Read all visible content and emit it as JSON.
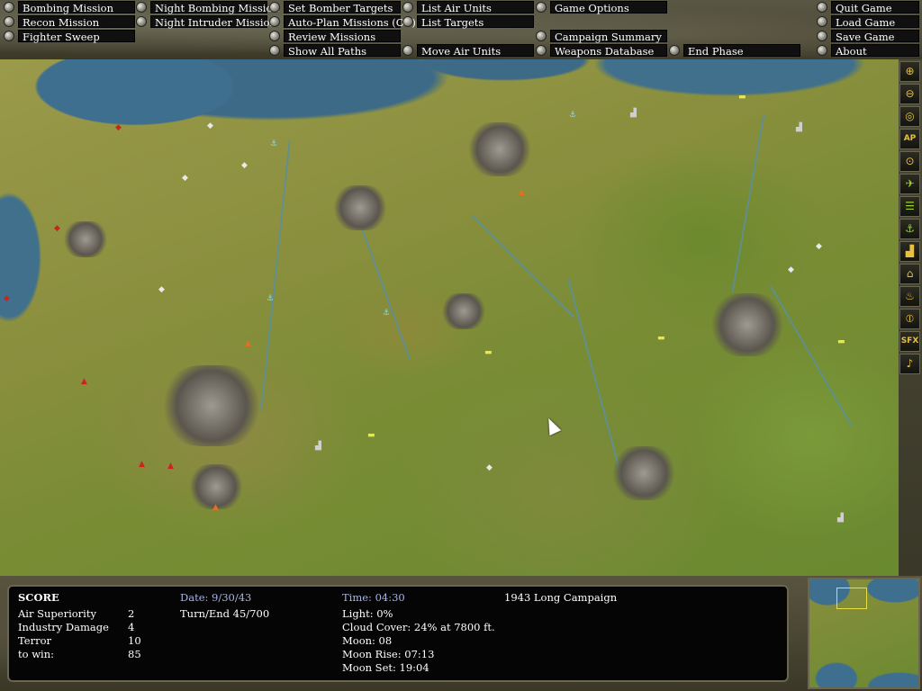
{
  "menu": {
    "bombing_mission": "Bombing Mission",
    "recon_mission": "Recon Mission",
    "fighter_sweep": "Fighter Sweep",
    "night_bombing_mission": "Night Bombing Mission",
    "night_intruder_mission": "Night Intruder Mission",
    "set_bomber_targets": "Set Bomber Targets",
    "auto_plan_missions": "Auto-Plan Missions (Off)",
    "review_missions": "Review Missions",
    "show_all_paths": "Show All Paths",
    "list_air_units": "List Air Units",
    "list_targets": "List Targets",
    "move_air_units": "Move Air Units",
    "game_options": "Game Options",
    "campaign_summary": "Campaign Summary",
    "weapons_database": "Weapons Database",
    "end_phase": "End Phase",
    "quit_game": "Quit Game",
    "load_game": "Load Game",
    "save_game": "Save Game",
    "about": "About"
  },
  "toolbar": {
    "ap_label": "AP",
    "sfx_label": "SFX",
    "icons": [
      "zoom-in-icon",
      "zoom-out-icon",
      "center-target-icon",
      "ap-icon",
      "waypoint-target-icon",
      "airfield-icon",
      "railway-icon",
      "anchor-icon",
      "factory-icon",
      "building-icon",
      "oil-icon",
      "compass-icon",
      "sfx-icon",
      "music-note-icon"
    ]
  },
  "status": {
    "score_title": "SCORE",
    "air_superiority_label": "Air Superiority",
    "air_superiority_value": "2",
    "industry_damage_label": "Industry Damage",
    "industry_damage_value": "4",
    "terror_label": "Terror",
    "terror_value": "10",
    "to_win_label": "to win:",
    "to_win_value": "85",
    "date": "Date: 9/30/43",
    "turn_end": "Turn/End  45/700",
    "time": "Time: 04:30",
    "light": "Light: 0%",
    "cloud_cover": "Cloud Cover: 24% at 7800 ft.",
    "moon": "Moon: 08",
    "moon_rise": "Moon Rise: 07:13",
    "moon_set": "Moon Set: 19:04",
    "campaign": "1943 Long Campaign"
  },
  "colors": {
    "sea": "#3f6f8f",
    "land": "#8a8f3e",
    "panel_bg": "#050505",
    "blue_text": "#a8b4e8",
    "tool_icon": "#e6c040"
  }
}
